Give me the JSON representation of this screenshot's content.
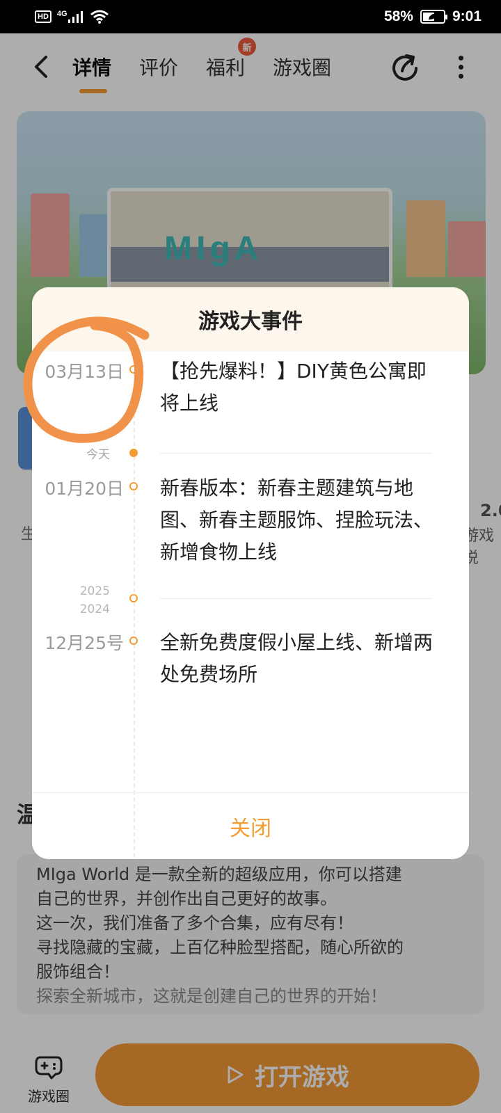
{
  "status_bar": {
    "hd": "HD",
    "network": "4G",
    "battery_percent": "58%",
    "battery_level": 0.58,
    "time": "9:01"
  },
  "header": {
    "tabs": [
      {
        "label": "详情",
        "active": true
      },
      {
        "label": "评价",
        "active": false
      },
      {
        "label": "福利",
        "active": false,
        "badge": "新"
      },
      {
        "label": "游戏圈",
        "active": false
      }
    ],
    "icons": [
      "back-icon",
      "share-icon",
      "more-icon"
    ]
  },
  "background": {
    "banner_logo": "MIgA",
    "left_clip_text": "生",
    "right_clip_number": "2.0",
    "right_clip_text": "游戏说",
    "section_heading": "温",
    "description": [
      "MIga World 是一款全新的超级应用，你可以搭建",
      "自己的世界，并创作出自己更好的故事。",
      "这一次，我们准备了多个合集，应有尽有！",
      "寻找隐藏的宝藏，上百亿种脸型搭配，随心所欲的",
      "服饰组合！",
      "探索全新城市，这就是创建自己的世界的开始！"
    ]
  },
  "bottom_bar": {
    "circle_label": "游戏圈",
    "open_game_label": "打开游戏"
  },
  "dialog": {
    "title": "游戏大事件",
    "today_label": "今天",
    "year_current": "2025",
    "year_previous": "2024",
    "events": [
      {
        "date": "03月13日",
        "text": "【抢先爆料！】DIY黄色公寓即将上线"
      },
      {
        "date": "01月20日",
        "text": "新春版本：新春主题建筑与地图、新春主题服饰、捏脸玩法、新增食物上线"
      },
      {
        "date": "12月25号",
        "text": "全新免费度假小屋上线、新增两处免费场所"
      }
    ],
    "close_label": "关闭"
  },
  "colors": {
    "accent": "#f39c32",
    "annotation": "#f0924a",
    "dialog_header_bg": "#fdf6ec"
  }
}
